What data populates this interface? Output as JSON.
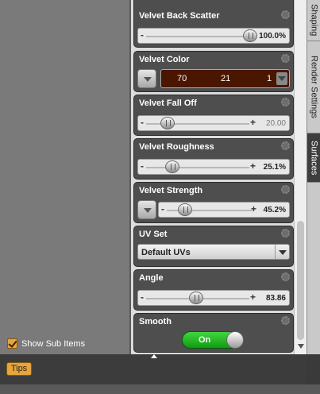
{
  "tree": {
    "show_sub_items_label": "Show Sub Items",
    "show_sub_items_checked": true
  },
  "properties": {
    "velvet_back_scatter": {
      "title": "Velvet Back Scatter",
      "value": "100.0%",
      "level": 1.0
    },
    "velvet_color": {
      "title": "Velvet Color",
      "r": "70",
      "g": "21",
      "b": "1",
      "color": "#4a1600"
    },
    "velvet_fall_off": {
      "title": "Velvet Fall Off",
      "value": "20.00"
    },
    "velvet_roughness": {
      "title": "Velvet Roughness",
      "value": "25.1%",
      "level": 0.251
    },
    "velvet_strength": {
      "title": "Velvet Strength",
      "value": "45.2%",
      "level": 0.452
    },
    "uv_set": {
      "title": "UV Set",
      "selected": "Default UVs"
    },
    "angle": {
      "title": "Angle",
      "value": "83.86"
    },
    "smooth": {
      "title": "Smooth",
      "state": "On"
    }
  },
  "tabs": [
    {
      "label": "Shaping"
    },
    {
      "label": "Render Settings"
    },
    {
      "label": "Surfaces",
      "active": true
    }
  ],
  "bottom": {
    "tips_label": "Tips"
  },
  "colors": {
    "accent": "#e8a53c",
    "toggle_on": "#22b822"
  }
}
